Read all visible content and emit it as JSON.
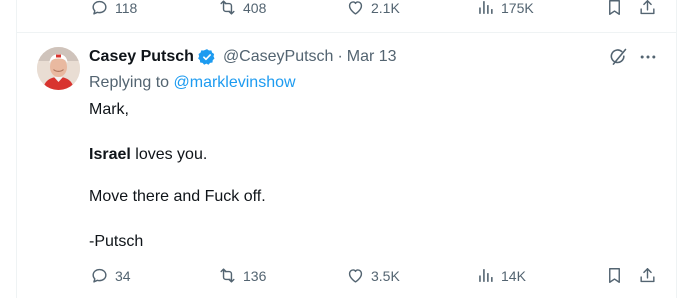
{
  "prev_tweet": {
    "actions": {
      "reply_count": "118",
      "repost_count": "408",
      "like_count": "2.1K",
      "view_count": "175K"
    }
  },
  "tweet": {
    "display_name": "Casey Putsch",
    "handle": "@CaseyPutsch",
    "separator": "·",
    "date": "Mar 13",
    "replying_prefix": "Replying to",
    "replying_handle": "@marklevinshow",
    "body": {
      "line1": "Mark,",
      "line2_bold": "Israel",
      "line2_rest": " loves you.",
      "line3": "Move there and Fuck off.",
      "line4": "-Putsch"
    },
    "actions": {
      "reply_count": "34",
      "repost_count": "136",
      "like_count": "3.5K",
      "view_count": "14K"
    }
  },
  "colors": {
    "text_primary": "#0f1419",
    "text_secondary": "#536471",
    "link": "#1d9bf0",
    "verified_badge": "#1d9bf0",
    "divider": "#eff3f4"
  },
  "icons": [
    "reply-icon",
    "repost-icon",
    "like-icon",
    "views-icon",
    "bookmark-icon",
    "share-icon",
    "verified-badge-icon",
    "grok-icon",
    "more-icon"
  ]
}
